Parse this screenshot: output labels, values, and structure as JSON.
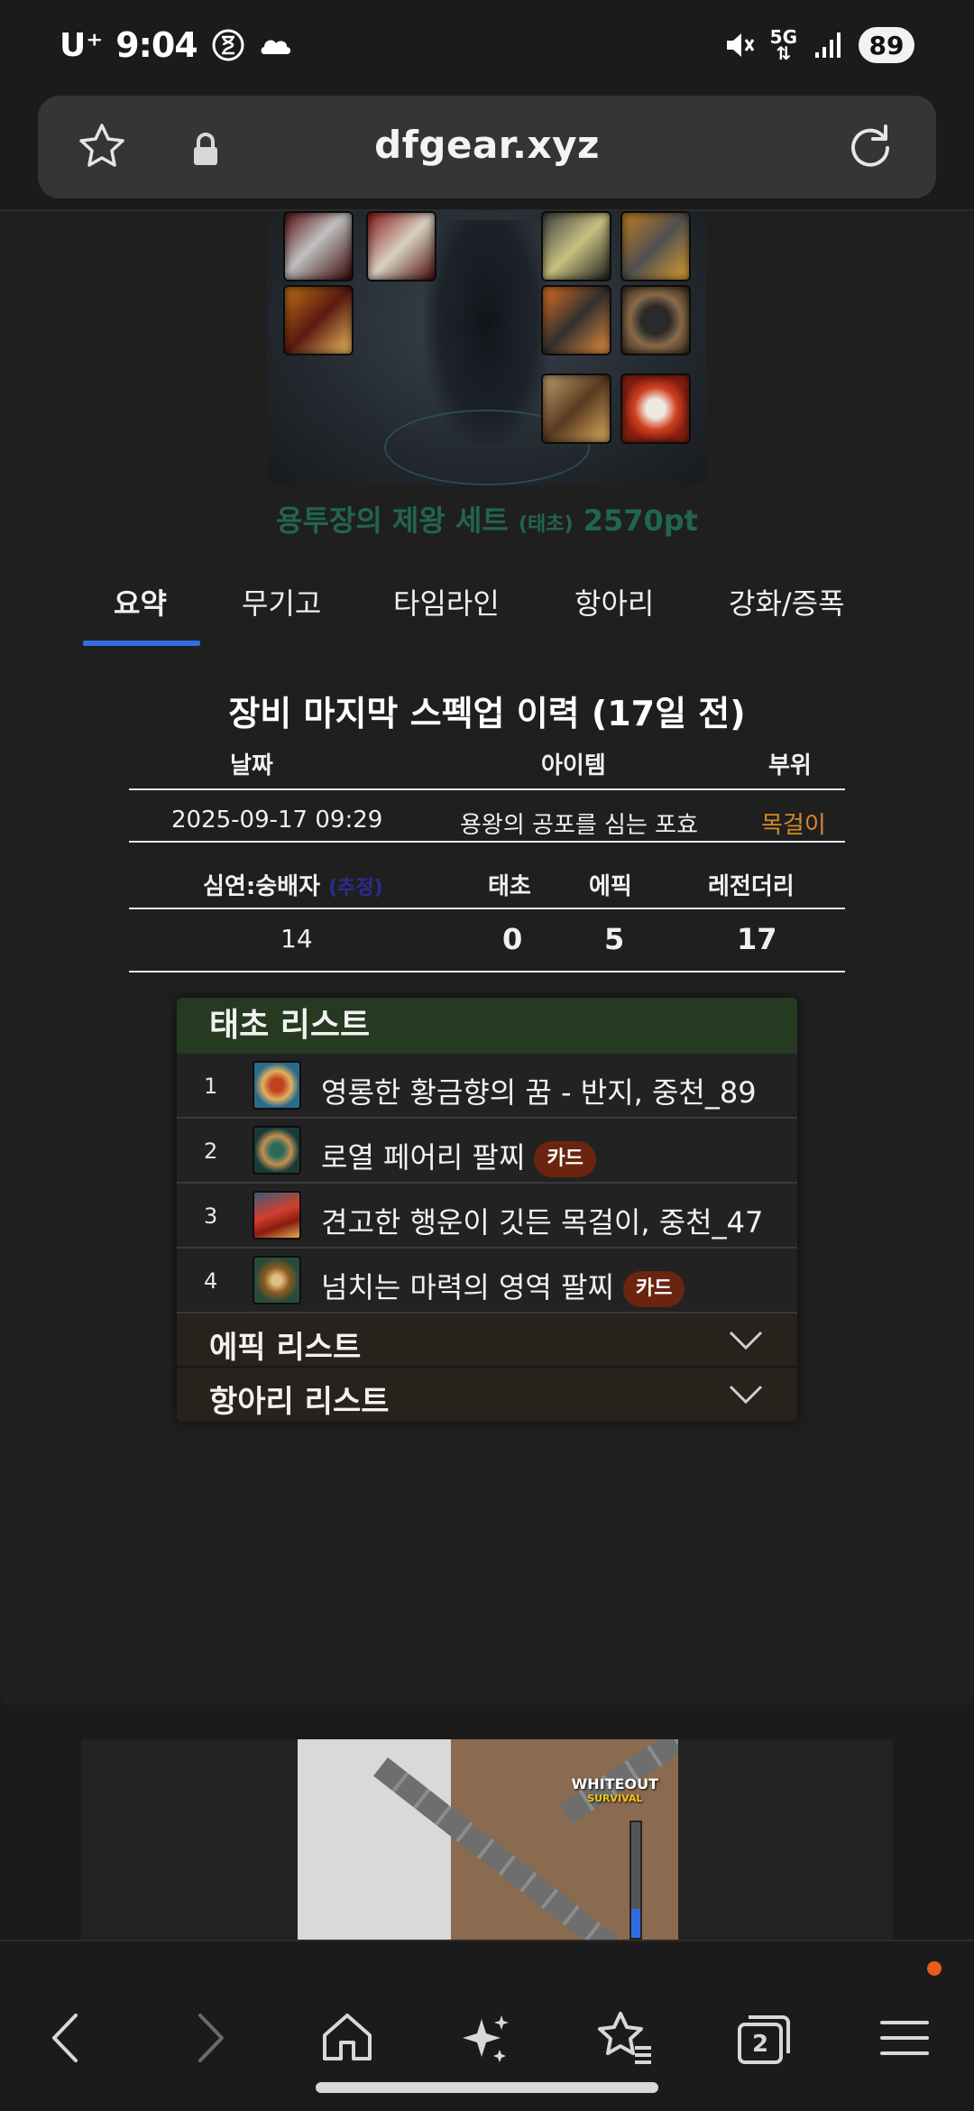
{
  "status_bar": {
    "carrier": "U⁺",
    "time": "9:04",
    "network": "5G",
    "battery": "89"
  },
  "url_bar": {
    "domain": "dfgear.xyz"
  },
  "equipment": {
    "set_name": "용투장의 제왕 세트",
    "set_grade": "(태초)",
    "set_points": "2570pt"
  },
  "tabs": [
    {
      "label": "요약",
      "active": true
    },
    {
      "label": "무기고",
      "active": false
    },
    {
      "label": "타임라인",
      "active": false
    },
    {
      "label": "항아리",
      "active": false
    },
    {
      "label": "강화/증폭",
      "active": false
    }
  ],
  "history": {
    "title": "장비 마지막 스펙업 이력 (17일 전)",
    "headers": {
      "date": "날짜",
      "item": "아이템",
      "slot": "부위"
    },
    "entry": {
      "date": "2025-09-17 09:29",
      "item": "용왕의 공포를 심는 포효",
      "slot": "목걸이"
    },
    "stats_headers": {
      "abyss": "심연:숭배자",
      "abyss_note": "(추정)",
      "taecho": "태초",
      "epic": "에픽",
      "legendary": "레전더리"
    },
    "stats": {
      "abyss": "14",
      "taecho": "0",
      "epic": "5",
      "legendary": "17"
    }
  },
  "taecho_list": {
    "title": "태초 리스트",
    "items": [
      {
        "num": "1",
        "name": "영롱한 황금향의 꿈 - 반지, 중천_89",
        "badge": ""
      },
      {
        "num": "2",
        "name": "로열 페어리 팔찌",
        "badge": "카드"
      },
      {
        "num": "3",
        "name": "견고한 행운이 깃든 목걸이, 중천_47",
        "badge": ""
      },
      {
        "num": "4",
        "name": "넘치는 마력의 영역 팔찌",
        "badge": "카드"
      }
    ]
  },
  "collapsibles": {
    "epic": "에픽 리스트",
    "pot": "항아리 리스트"
  },
  "ad": {
    "logo_line1": "WHITEOUT",
    "logo_line2": "SURVIVAL"
  },
  "bottom_nav": {
    "tabs_count": "2"
  },
  "colors": {
    "accent_blue": "#2f6de0",
    "set_green": "#21654f",
    "necklace_orange": "#d78a28",
    "card_badge": "#6b2410",
    "taecho_header": "#253a20",
    "notification_dot": "#e85d1a"
  }
}
